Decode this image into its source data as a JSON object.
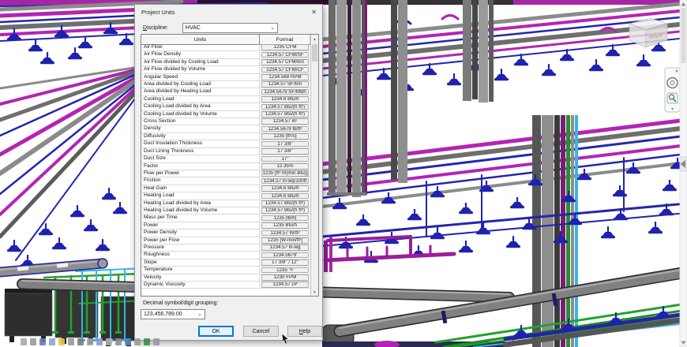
{
  "dialog": {
    "title": "Project Units",
    "discipline_label": "Discipline:",
    "discipline_value": "HVAC",
    "table": {
      "headers": [
        "Units",
        "Format"
      ],
      "rows": [
        {
          "unit": "Air Flow",
          "format": "1235 CFM"
        },
        {
          "unit": "Air Flow Density",
          "format": "1234.57 CFM/SF"
        },
        {
          "unit": "Air Flow divided by Cooling Load",
          "format": "1234.57 CFM/ton"
        },
        {
          "unit": "Air Flow divided by Volume",
          "format": "1234.57 CFM/CF"
        },
        {
          "unit": "Angular Speed",
          "format": "1234.568 RPM"
        },
        {
          "unit": "Area divided by Cooling Load",
          "format": "1234.57 SF/ton"
        },
        {
          "unit": "Area divided by Heating Load",
          "format": "1234.5679 SF/MBh"
        },
        {
          "unit": "Cooling Load",
          "format": "1234.6 Btu/h"
        },
        {
          "unit": "Cooling Load divided by Area",
          "format": "1234.57 Btu/(h·ft²)"
        },
        {
          "unit": "Cooling Load divided by Volume",
          "format": "1234.57 Btu/(h·ft³)"
        },
        {
          "unit": "Cross Section",
          "format": "1234.57 in²"
        },
        {
          "unit": "Density",
          "format": "1234.5679 lb/ft³"
        },
        {
          "unit": "Diffusivity",
          "format": "1235 [ft²/s]"
        },
        {
          "unit": "Duct Insulation Thickness",
          "format": "17 3/8\""
        },
        {
          "unit": "Duct Lining Thickness",
          "format": "17 3/8\""
        },
        {
          "unit": "Duct Size",
          "format": "17\""
        },
        {
          "unit": "Factor",
          "format": "12.35%"
        },
        {
          "unit": "Flow per Power",
          "format": "1235 [ft³·h/(min-Btu)]"
        },
        {
          "unit": "Friction",
          "format": "1234.57 in-wg/100ft"
        },
        {
          "unit": "Heat Gain",
          "format": "1234.6 Btu/h"
        },
        {
          "unit": "Heating Load",
          "format": "1234.6 Btu/h"
        },
        {
          "unit": "Heating Load divided by Area",
          "format": "1234.57 Btu/(h·ft²)"
        },
        {
          "unit": "Heating Load divided by Volume",
          "format": "1234.57 Btu/(h·ft³)"
        },
        {
          "unit": "Mass per Time",
          "format": "1235 [lb/h]"
        },
        {
          "unit": "Power",
          "format": "1235 Btu/h"
        },
        {
          "unit": "Power Density",
          "format": "1234.57 W/ft²"
        },
        {
          "unit": "Power per Flow",
          "format": "1235 [W-min/ft³]"
        },
        {
          "unit": "Pressure",
          "format": "1234.57 in-wg"
        },
        {
          "unit": "Roughness",
          "format": "1234.5679'"
        },
        {
          "unit": "Slope",
          "format": "17 3/8\" / 12\""
        },
        {
          "unit": "Temperature",
          "format": "1235 °F"
        },
        {
          "unit": "Velocity",
          "format": "1230 FPM"
        },
        {
          "unit": "Dynamic Viscosity",
          "format": "1234.57 cP"
        }
      ]
    },
    "decimal_label": "Decimal symbol/digit grouping:",
    "decimal_value": "123,456,789.00",
    "buttons": {
      "ok": "OK",
      "cancel": "Cancel",
      "help": "Help"
    }
  },
  "icons": {
    "close": "✕",
    "chevron_down": "⌄",
    "scroll_up": "▲",
    "scroll_down": "▼"
  },
  "viewport": {
    "viewcube_label": "RIGHT",
    "colors": {
      "accent_blue": "#0078d7",
      "duct_magenta": "#b424b4",
      "pipe_blue": "#2326ad",
      "pipe_green": "#22a32b",
      "pipe_cyan": "#38b6de",
      "duct_gray": "#8b8b8b"
    }
  }
}
